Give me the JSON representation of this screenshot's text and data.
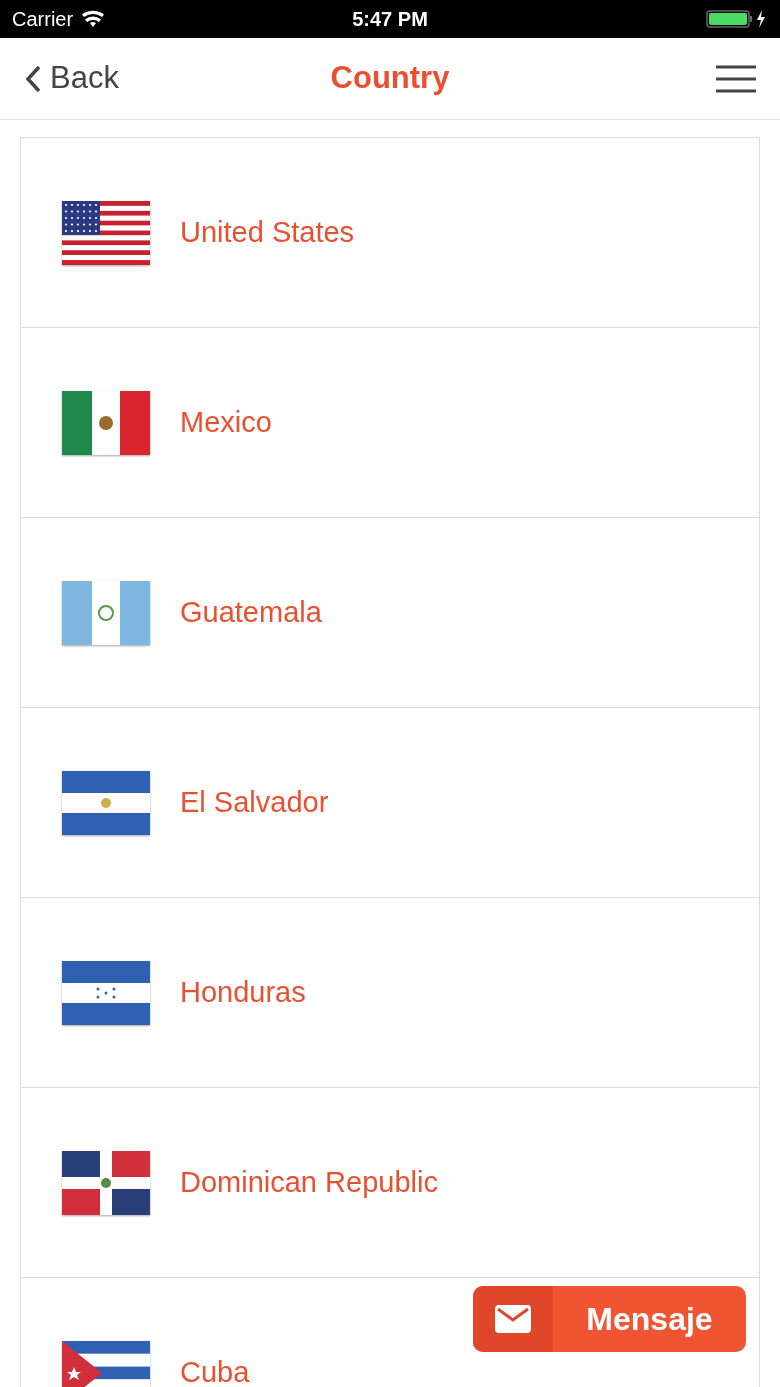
{
  "status_bar": {
    "carrier": "Carrier",
    "time": "5:47 PM"
  },
  "nav": {
    "back": "Back",
    "title": "Country"
  },
  "countries": [
    {
      "name": "United States",
      "kind": "usa"
    },
    {
      "name": "Mexico",
      "kind": "mexico"
    },
    {
      "name": "Guatemala",
      "kind": "guatemala"
    },
    {
      "name": "El Salvador",
      "kind": "salvador"
    },
    {
      "name": "Honduras",
      "kind": "honduras"
    },
    {
      "name": "Dominican Republic",
      "kind": "dominican"
    },
    {
      "name": "Cuba",
      "kind": "cuba"
    }
  ],
  "message_button": {
    "label": "Mensaje"
  }
}
